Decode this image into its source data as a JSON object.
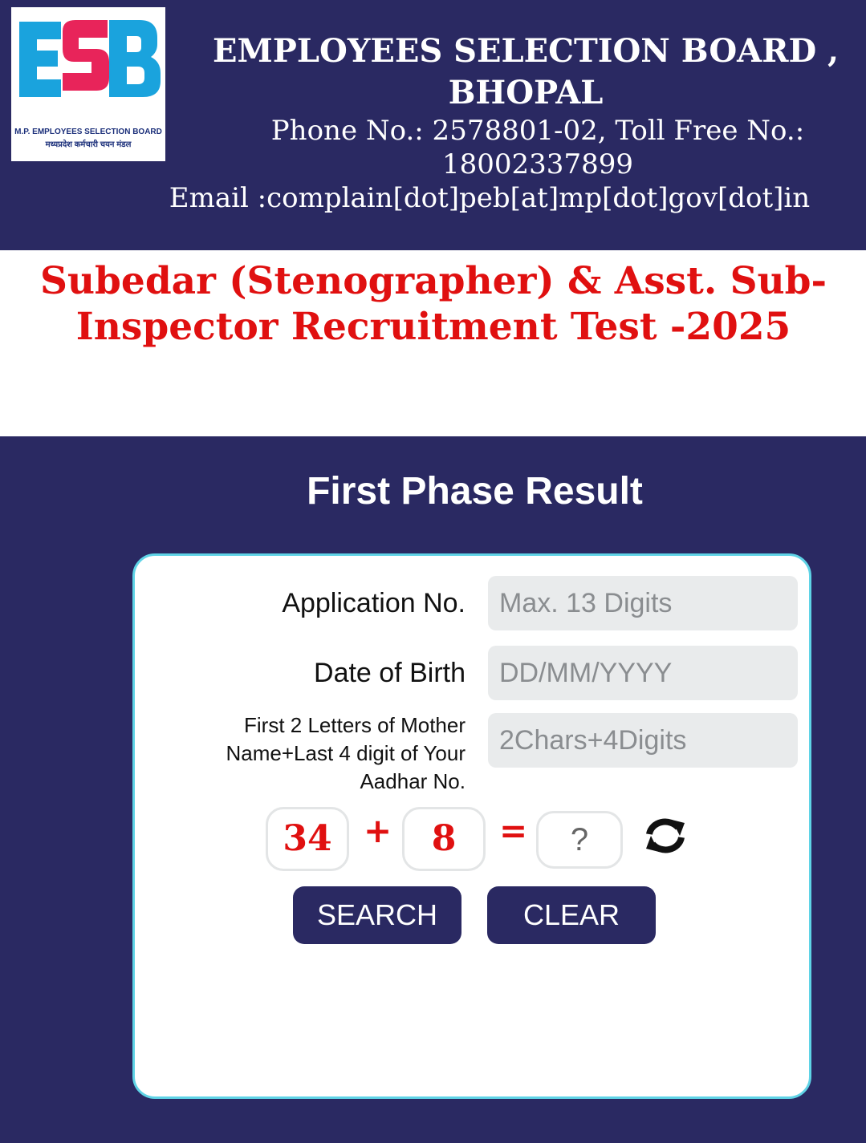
{
  "header": {
    "logo": {
      "letters": "ESB",
      "caption_en": "M.P. EMPLOYEES SELECTION BOARD",
      "caption_hi": "मध्यप्रदेश कर्मचारी चयन मंडल"
    },
    "title": "EMPLOYEES SELECTION BOARD , BHOPAL",
    "phone_line": "Phone No.: 2578801-02, Toll Free No.: 18002337899",
    "email_line": "Email :complain[dot]peb[at]mp[dot]gov[dot]in"
  },
  "exam": {
    "title": "Subedar (Stenographer) & Asst. Sub-Inspector Recruitment Test -2025"
  },
  "section": {
    "title": "First Phase Result"
  },
  "form": {
    "application_no": {
      "label": "Application No.",
      "placeholder": "Max. 13 Digits",
      "value": ""
    },
    "dob": {
      "label": "Date of Birth",
      "placeholder": "DD/MM/YYYY",
      "value": ""
    },
    "mother_aadhar": {
      "label": "First 2 Letters of Mother Name+Last 4 digit of Your Aadhar No.",
      "placeholder": "2Chars+4Digits",
      "value": ""
    },
    "captcha": {
      "a": "34",
      "plus": "+",
      "b": "8",
      "equals": "=",
      "answer_placeholder": "?"
    },
    "search_label": "SEARCH",
    "clear_label": "CLEAR"
  },
  "colors": {
    "navy": "#2a2962",
    "accent_red": "#e01010",
    "card_border": "#5fd3e6",
    "logo_blue": "#1aa3dd",
    "logo_pink": "#e8245a"
  },
  "icons": {
    "refresh": "refresh-icon"
  }
}
